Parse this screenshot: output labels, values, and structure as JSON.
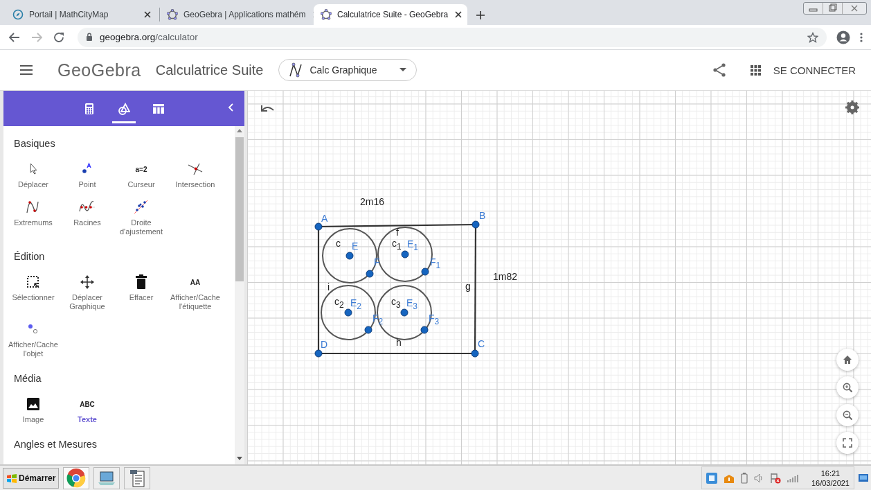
{
  "browser": {
    "tabs": [
      {
        "title": "Portail | MathCityMap",
        "selected": false
      },
      {
        "title": "GeoGebra | Applications mathém",
        "selected": false
      },
      {
        "title": "Calculatrice Suite - GeoGebra",
        "selected": true
      }
    ],
    "url_host": "geogebra.org",
    "url_path": "/calculator"
  },
  "header": {
    "logo": "GeoGebra",
    "app_title": "Calculatrice Suite",
    "app_switcher": "Calc Graphique",
    "sign_in": "SE CONNECTER"
  },
  "sidebar": {
    "view_tabs": [
      {
        "selected": false
      },
      {
        "selected": true
      },
      {
        "selected": false
      }
    ],
    "sections": [
      {
        "title": "Basiques",
        "tools": [
          {
            "label": "Déplacer",
            "selected": false
          },
          {
            "label": "Point",
            "selected": false
          },
          {
            "label": "Curseur",
            "selected": false,
            "glyph": "a=2"
          },
          {
            "label": "Intersection",
            "selected": false
          },
          {
            "label": "Extremums",
            "selected": false
          },
          {
            "label": "Racines",
            "selected": false
          },
          {
            "label": "Droite d'ajustement",
            "selected": false
          }
        ]
      },
      {
        "title": "Édition",
        "tools": [
          {
            "label": "Sélectionner",
            "selected": false
          },
          {
            "label": "Déplacer Graphique",
            "selected": false
          },
          {
            "label": "Effacer",
            "selected": false
          },
          {
            "label": "Afficher/Cache l'étiquette",
            "selected": false,
            "glyph": "AA"
          },
          {
            "label": "Afficher/Cache l'objet",
            "selected": false
          }
        ]
      },
      {
        "title": "Média",
        "tools": [
          {
            "label": "Image",
            "selected": false
          },
          {
            "label": "Texte",
            "selected": true,
            "glyph": "ABC"
          }
        ]
      },
      {
        "title": "Angles et Mesures"
      }
    ]
  },
  "graphics": {
    "points": [
      {
        "label": "A"
      },
      {
        "label": "B"
      },
      {
        "label": "C"
      },
      {
        "label": "D"
      },
      {
        "label": "E"
      },
      {
        "label": "F"
      },
      {
        "label": "E$_{1}$"
      },
      {
        "label": "F$_{1}$"
      },
      {
        "label": "E$_{2}$"
      },
      {
        "label": "F$_{2}$"
      },
      {
        "label": "E$_{3}$"
      },
      {
        "label": "F$_{3}$"
      }
    ],
    "object_labels": [
      "f",
      "c",
      "c$_{1}$",
      "i",
      "g",
      "c$_{2}$",
      "c$_{3}$",
      "h"
    ],
    "texts": [
      "2m16",
      "1m82"
    ]
  },
  "taskbar": {
    "start": "Démarrer",
    "time": "16:21",
    "date": "16/03/2021"
  }
}
